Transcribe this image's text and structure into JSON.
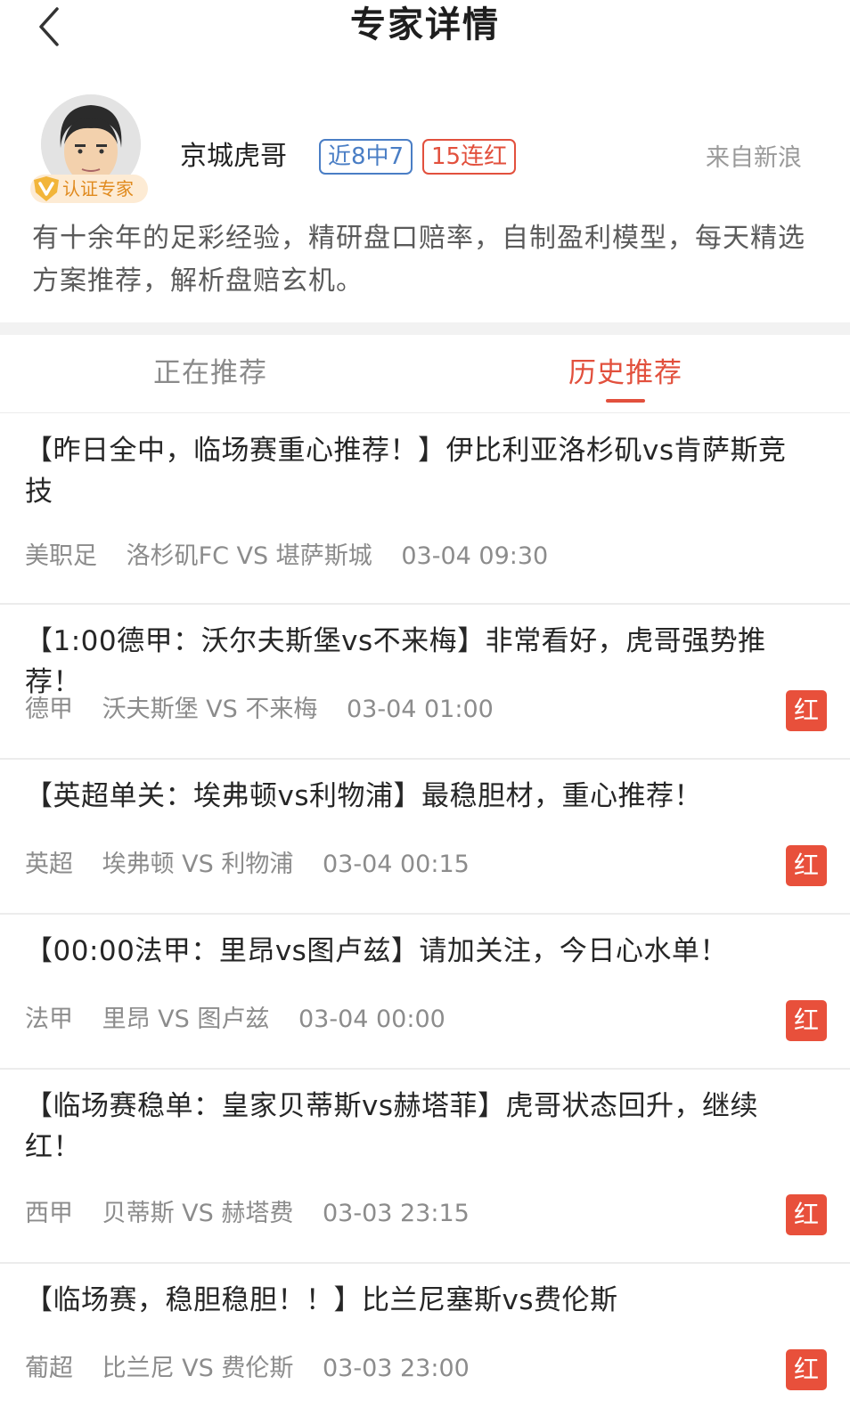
{
  "nav": {
    "title": "专家详情"
  },
  "expert": {
    "name": "京城虎哥",
    "cert_label": "认证专家",
    "tag_hit": "近8中7",
    "tag_streak": "15连红",
    "source": "来自新浪",
    "bio": "有十余年的足彩经验，精研盘口赔率，自制盈利模型，每天精选方案推荐，解析盘赔玄机。"
  },
  "tabs": [
    {
      "label": "正在推荐",
      "active": false
    },
    {
      "label": "历史推荐",
      "active": true
    }
  ],
  "items": [
    {
      "title": "【昨日全中，临场赛重心推荐！】伊比利亚洛杉矶vs肯萨斯竞技",
      "league": "美职足",
      "match": "洛杉矶FC VS 堪萨斯城",
      "time": "03-04 09:30",
      "result": ""
    },
    {
      "title": "【1:00德甲：沃尔夫斯堡vs不来梅】非常看好，虎哥强势推荐！",
      "league": "德甲",
      "match": "沃夫斯堡 VS 不来梅",
      "time": "03-04 01:00",
      "result": "红"
    },
    {
      "title": "【英超单关：埃弗顿vs利物浦】最稳胆材，重心推荐！",
      "league": "英超",
      "match": "埃弗顿 VS 利物浦",
      "time": "03-04 00:15",
      "result": "红"
    },
    {
      "title": "【00:00法甲：里昂vs图卢兹】请加关注，今日心水单！",
      "league": "法甲",
      "match": "里昂 VS 图卢兹",
      "time": "03-04 00:00",
      "result": "红"
    },
    {
      "title": "【临场赛稳单：皇家贝蒂斯vs赫塔菲】虎哥状态回升，继续红！",
      "league": "西甲",
      "match": "贝蒂斯 VS 赫塔费",
      "time": "03-03 23:15",
      "result": "红"
    },
    {
      "title": "【临场赛，稳胆稳胆！！】比兰尼塞斯vs费伦斯",
      "league": "葡超",
      "match": "比兰尼 VS 费伦斯",
      "time": "03-03 23:00",
      "result": "红"
    }
  ],
  "colors": {
    "accent_red": "#e2503d",
    "tag_blue": "#4a7ec5",
    "cert_gold": "#e08a1e"
  }
}
